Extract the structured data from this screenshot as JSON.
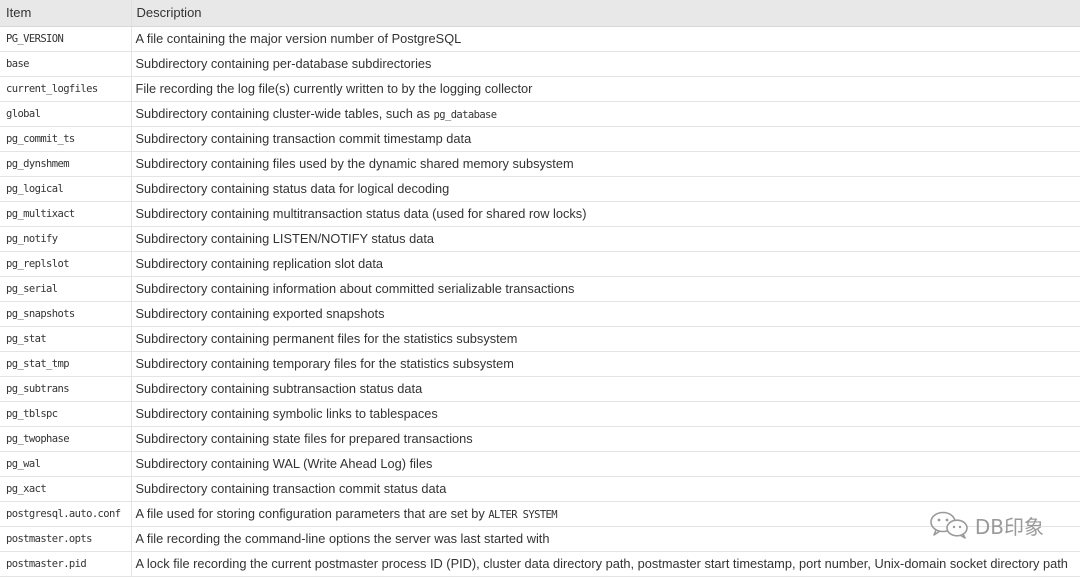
{
  "table": {
    "headers": {
      "item": "Item",
      "description": "Description"
    },
    "rows": [
      {
        "item": "PG_VERSION",
        "description": "A file containing the major version number of PostgreSQL"
      },
      {
        "item": "base",
        "description": "Subdirectory containing per-database subdirectories"
      },
      {
        "item": "current_logfiles",
        "description": "File recording the log file(s) currently written to by the logging collector"
      },
      {
        "item": "global",
        "description": "Subdirectory containing cluster-wide tables, such as ",
        "code": "pg_database"
      },
      {
        "item": "pg_commit_ts",
        "description": "Subdirectory containing transaction commit timestamp data"
      },
      {
        "item": "pg_dynshmem",
        "description": "Subdirectory containing files used by the dynamic shared memory subsystem"
      },
      {
        "item": "pg_logical",
        "description": "Subdirectory containing status data for logical decoding"
      },
      {
        "item": "pg_multixact",
        "description": "Subdirectory containing multitransaction status data (used for shared row locks)"
      },
      {
        "item": "pg_notify",
        "description": "Subdirectory containing LISTEN/NOTIFY status data"
      },
      {
        "item": "pg_replslot",
        "description": "Subdirectory containing replication slot data"
      },
      {
        "item": "pg_serial",
        "description": "Subdirectory containing information about committed serializable transactions"
      },
      {
        "item": "pg_snapshots",
        "description": "Subdirectory containing exported snapshots"
      },
      {
        "item": "pg_stat",
        "description": "Subdirectory containing permanent files for the statistics subsystem"
      },
      {
        "item": "pg_stat_tmp",
        "description": "Subdirectory containing temporary files for the statistics subsystem"
      },
      {
        "item": "pg_subtrans",
        "description": "Subdirectory containing subtransaction status data"
      },
      {
        "item": "pg_tblspc",
        "description": "Subdirectory containing symbolic links to tablespaces"
      },
      {
        "item": "pg_twophase",
        "description": "Subdirectory containing state files for prepared transactions"
      },
      {
        "item": "pg_wal",
        "description": "Subdirectory containing WAL (Write Ahead Log) files"
      },
      {
        "item": "pg_xact",
        "description": "Subdirectory containing transaction commit status data"
      },
      {
        "item": "postgresql.auto.conf",
        "description": "A file used for storing configuration parameters that are set by ",
        "code": "ALTER SYSTEM"
      },
      {
        "item": "postmaster.opts",
        "description": "A file recording the command-line options the server was last started with"
      },
      {
        "item": "postmaster.pid",
        "description": "A lock file recording the current postmaster process ID (PID), cluster data directory path, postmaster start timestamp, port number, Unix-domain socket directory path"
      }
    ]
  },
  "watermark": {
    "icon": "wechat-icon",
    "text": "DB印象"
  }
}
